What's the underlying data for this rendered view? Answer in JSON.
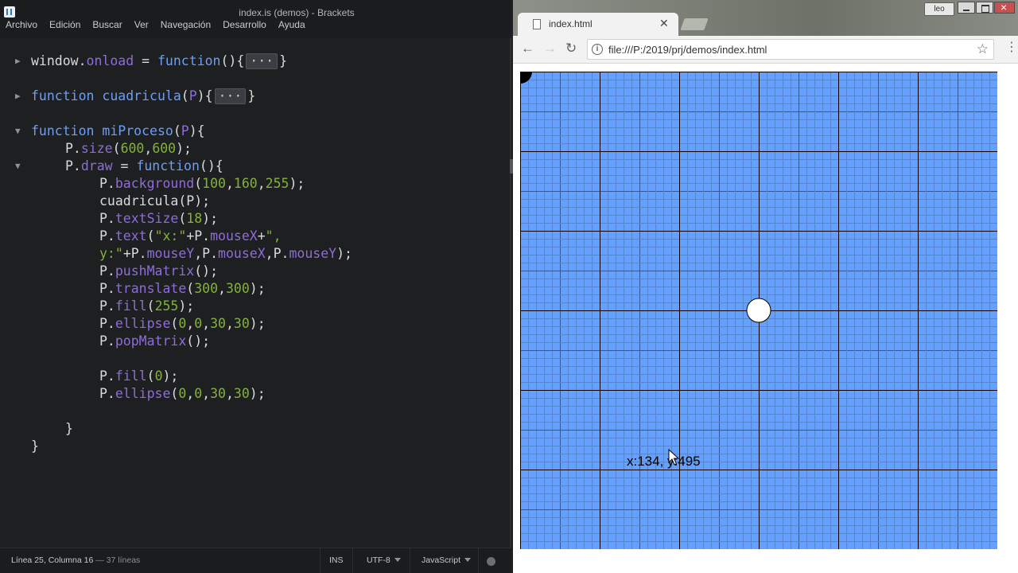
{
  "editor": {
    "window_title": "index.is (demos) - Brackets",
    "menu": [
      "Archivo",
      "Edición",
      "Buscar",
      "Ver",
      "Navegación",
      "Desarrollo",
      "Ayuda"
    ],
    "status": {
      "cursor": "Línea 25, Columna 16",
      "lines": "— 37 líneas",
      "mode": "INS",
      "encoding": "UTF-8",
      "language": "JavaScript"
    }
  },
  "browser": {
    "tab_title": "index.html",
    "user_badge": "leo",
    "url": "file:///P:/2019/prj/demos/index.html"
  },
  "sketch": {
    "background_color": "#64a0ff",
    "grid_line_color": "#000000",
    "mouse_text": "x:134, y:495",
    "center_circle": {
      "fill": "#ffffff"
    },
    "corner_circle": {
      "fill": "#000000"
    }
  }
}
